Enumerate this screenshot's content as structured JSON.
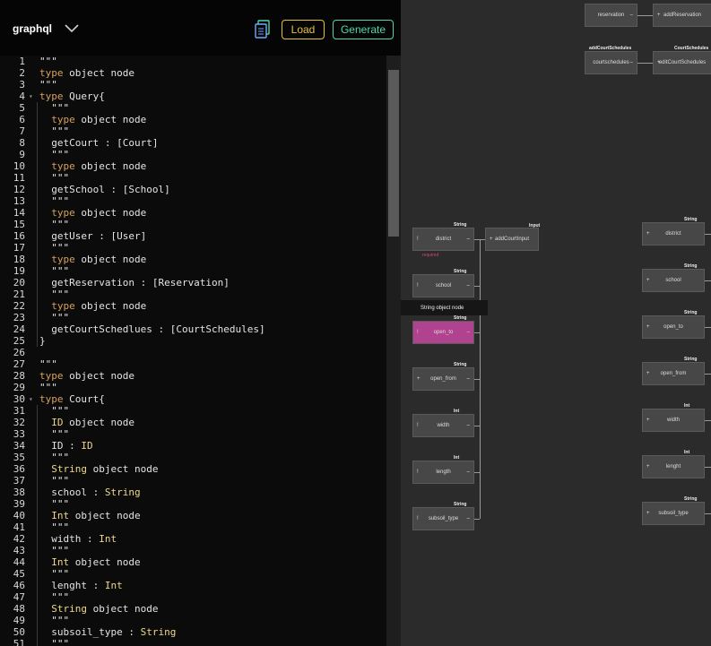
{
  "header": {
    "schema_name": "graphql",
    "load_label": "Load",
    "generate_label": "Generate"
  },
  "editor": {
    "lines": [
      {
        "n": "1",
        "t": "\"\"\""
      },
      {
        "n": "2",
        "t": "type object node"
      },
      {
        "n": "3",
        "t": "\"\"\""
      },
      {
        "n": "4",
        "t": "type Query{"
      },
      {
        "n": "5",
        "t": "  \"\"\""
      },
      {
        "n": "6",
        "t": "  type object node"
      },
      {
        "n": "7",
        "t": "  \"\"\""
      },
      {
        "n": "8",
        "t": "  getCourt : [Court]"
      },
      {
        "n": "9",
        "t": "  \"\"\""
      },
      {
        "n": "10",
        "t": "  type object node"
      },
      {
        "n": "11",
        "t": "  \"\"\""
      },
      {
        "n": "12",
        "t": "  getSchool : [School]"
      },
      {
        "n": "13",
        "t": "  \"\"\""
      },
      {
        "n": "14",
        "t": "  type object node"
      },
      {
        "n": "15",
        "t": "  \"\"\""
      },
      {
        "n": "16",
        "t": "  getUser : [User]"
      },
      {
        "n": "17",
        "t": "  \"\"\""
      },
      {
        "n": "18",
        "t": "  type object node"
      },
      {
        "n": "19",
        "t": "  \"\"\""
      },
      {
        "n": "20",
        "t": "  getReservation : [Reservation]"
      },
      {
        "n": "21",
        "t": "  \"\"\""
      },
      {
        "n": "22",
        "t": "  type object node"
      },
      {
        "n": "23",
        "t": "  \"\"\""
      },
      {
        "n": "24",
        "t": "  getCourtSchedlues : [CourtSchedules]"
      },
      {
        "n": "25",
        "t": "}"
      },
      {
        "n": "26",
        "t": ""
      },
      {
        "n": "27",
        "t": "\"\"\""
      },
      {
        "n": "28",
        "t": "type object node"
      },
      {
        "n": "29",
        "t": "\"\"\""
      },
      {
        "n": "30",
        "t": "type Court{"
      },
      {
        "n": "31",
        "t": "  \"\"\""
      },
      {
        "n": "32",
        "t": "  ID object node"
      },
      {
        "n": "33",
        "t": "  \"\"\""
      },
      {
        "n": "34",
        "t": "  ID : ID"
      },
      {
        "n": "35",
        "t": "  \"\"\""
      },
      {
        "n": "36",
        "t": "  String object node"
      },
      {
        "n": "37",
        "t": "  \"\"\""
      },
      {
        "n": "38",
        "t": "  school : String"
      },
      {
        "n": "39",
        "t": "  \"\"\""
      },
      {
        "n": "40",
        "t": "  Int object node"
      },
      {
        "n": "41",
        "t": "  \"\"\""
      },
      {
        "n": "42",
        "t": "  width : Int"
      },
      {
        "n": "43",
        "t": "  \"\"\""
      },
      {
        "n": "44",
        "t": "  Int object node"
      },
      {
        "n": "45",
        "t": "  \"\"\""
      },
      {
        "n": "46",
        "t": "  lenght : Int"
      },
      {
        "n": "47",
        "t": "  \"\"\""
      },
      {
        "n": "48",
        "t": "  String object node"
      },
      {
        "n": "49",
        "t": "  \"\"\""
      },
      {
        "n": "50",
        "t": "  subsoil_type : String"
      },
      {
        "n": "51",
        "t": "  \"\"\""
      }
    ]
  },
  "graph": {
    "top_nodes": [
      {
        "name": "reservation",
        "tr": "–"
      },
      {
        "name": "addReservation",
        "tl": "+"
      },
      {
        "name": "courtschedules",
        "tr": "–"
      },
      {
        "name": "editCourtSchedules",
        "tl": "+"
      }
    ],
    "top_tags": [
      "addCourtSchedules",
      "CourtSchedules"
    ],
    "tooltip": "String object node",
    "required_label": "required",
    "input_tag": "Input",
    "mid_target": "addCourtInput",
    "left_fields": [
      {
        "name": "district",
        "tag": "String",
        "tl": "!",
        "tr": "–"
      },
      {
        "name": "school",
        "tag": "String",
        "tl": "!",
        "tr": "–"
      },
      {
        "name": "open_to",
        "tag": "String",
        "tl": "!",
        "tr": "–"
      },
      {
        "name": "open_from",
        "tag": "String",
        "tl": "+",
        "tr": "–"
      },
      {
        "name": "width",
        "tag": "Int",
        "tl": "!",
        "tr": "–"
      },
      {
        "name": "length",
        "tag": "Int",
        "tl": "!",
        "tr": "–"
      },
      {
        "name": "subsoil_type",
        "tag": "String",
        "tl": "!",
        "tr": "–"
      }
    ],
    "right_fields": [
      {
        "name": "district",
        "tag": "String",
        "tl": "+"
      },
      {
        "name": "school",
        "tag": "String",
        "tl": "+"
      },
      {
        "name": "open_to",
        "tag": "String",
        "tl": "+"
      },
      {
        "name": "open_from",
        "tag": "String",
        "tl": "+"
      },
      {
        "name": "width",
        "tag": "Int",
        "tl": "+"
      },
      {
        "name": "lenght",
        "tag": "Int",
        "tl": "+"
      },
      {
        "name": "subsoil_type",
        "tag": "String",
        "tl": "+"
      }
    ],
    "highlight_color": "#b0428f"
  }
}
